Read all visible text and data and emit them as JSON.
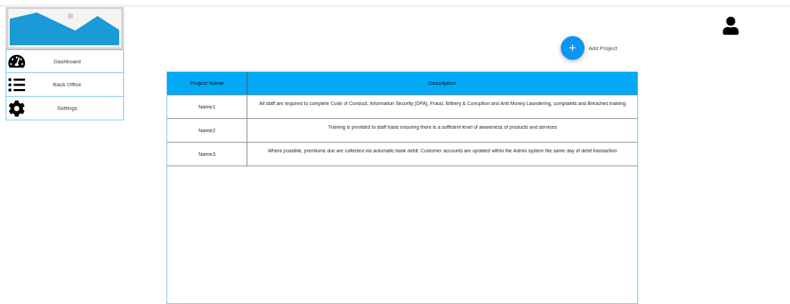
{
  "sidebar": {
    "items": [
      {
        "kind": "dashboard",
        "label": "Dashboard"
      },
      {
        "kind": "list",
        "label": "Back Office"
      },
      {
        "kind": "settings",
        "label": "Settings"
      }
    ]
  },
  "add_button": {
    "symbol": "+",
    "label": "Add Project"
  },
  "table": {
    "columns": [
      "Project Name",
      "Description"
    ],
    "rows": [
      [
        "Name1",
        "All staff are required to complete Code of Conduct, Information Security (DPA), Fraud, Bribery & Corruption and Anti-Money Laundering, complaints and Breaches training"
      ],
      [
        "Name2",
        "Training is provided to staff basis ensuring there is a sufficient level of awareness of products and services"
      ],
      [
        "Name3",
        "Where possible, premiums due are collected via automatic bank debit.  Customer accounts are updated within the Admin system the same day of debit transaction"
      ]
    ]
  }
}
